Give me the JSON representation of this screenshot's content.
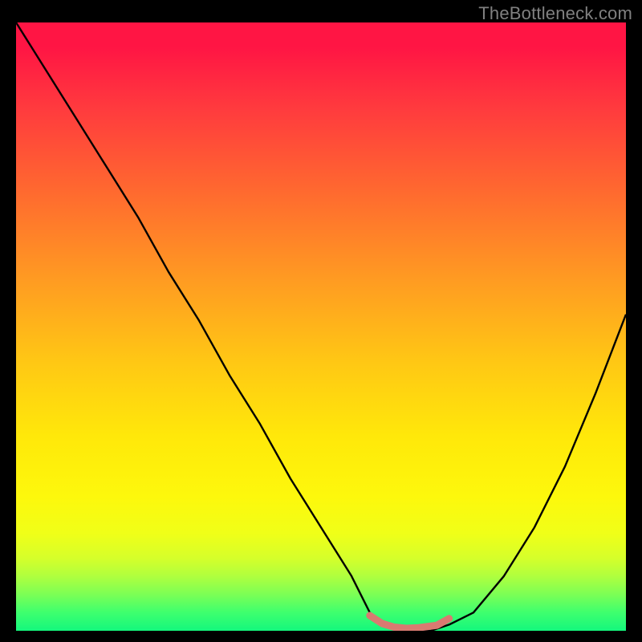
{
  "watermark": "TheBottleneck.com",
  "chart_data": {
    "type": "line",
    "title": "",
    "xlabel": "",
    "ylabel": "",
    "xlim": [
      0,
      100
    ],
    "ylim": [
      0,
      100
    ],
    "series": [
      {
        "name": "bottleneck-curve",
        "color": "#000000",
        "x": [
          0,
          5,
          10,
          15,
          20,
          25,
          30,
          35,
          40,
          45,
          50,
          55,
          58,
          60,
          63,
          66,
          68,
          71,
          75,
          80,
          85,
          90,
          95,
          100
        ],
        "y": [
          100,
          92,
          84,
          76,
          68,
          59,
          51,
          42,
          34,
          25,
          17,
          9,
          3,
          1,
          0,
          0,
          0,
          1,
          3,
          9,
          17,
          27,
          39,
          52
        ]
      },
      {
        "name": "optimal-segment",
        "color": "#d97a71",
        "x": [
          58,
          60,
          62,
          64,
          66,
          69,
          71
        ],
        "y": [
          2.5,
          1.2,
          0.6,
          0.4,
          0.5,
          0.9,
          2.0
        ]
      }
    ],
    "gradient_stops": [
      {
        "pos": 0,
        "color": "#ff1544"
      },
      {
        "pos": 50,
        "color": "#ffc814"
      },
      {
        "pos": 80,
        "color": "#fdf80c"
      },
      {
        "pos": 100,
        "color": "#14f77d"
      }
    ]
  }
}
